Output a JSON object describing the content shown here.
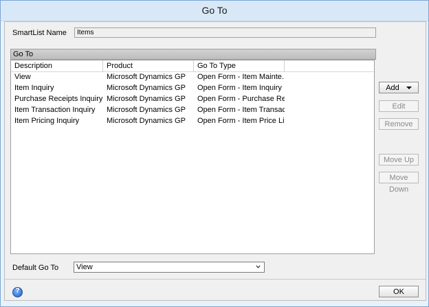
{
  "window": {
    "title": "Go To"
  },
  "smartlist": {
    "label": "SmartList Name",
    "value": "Items"
  },
  "group": {
    "header": "Go To"
  },
  "grid": {
    "columns": [
      "Description",
      "Product",
      "Go To Type",
      ""
    ],
    "rows": [
      [
        "View",
        "Microsoft Dynamics GP",
        "Open Form - Item Mainte..."
      ],
      [
        "Item Inquiry",
        "Microsoft Dynamics GP",
        "Open Form - Item Inquiry"
      ],
      [
        "Purchase Receipts Inquiry",
        "Microsoft Dynamics GP",
        "Open Form - Purchase Re..."
      ],
      [
        "Item Transaction Inquiry",
        "Microsoft Dynamics GP",
        "Open Form - Item Transac..."
      ],
      [
        "Item Pricing Inquiry",
        "Microsoft Dynamics GP",
        "Open Form - Item Price Li..."
      ]
    ]
  },
  "buttons": {
    "add": "Add",
    "edit": "Edit",
    "remove": "Remove",
    "move_up": "Move Up",
    "move_down": "Move Down",
    "ok": "OK"
  },
  "default_goto": {
    "label": "Default Go To",
    "value": "View"
  },
  "help": {
    "glyph": "?"
  },
  "colors": {
    "title_bg": "#d9e8f7",
    "border": "#7aa6d4",
    "help": "#1f5fc4"
  }
}
